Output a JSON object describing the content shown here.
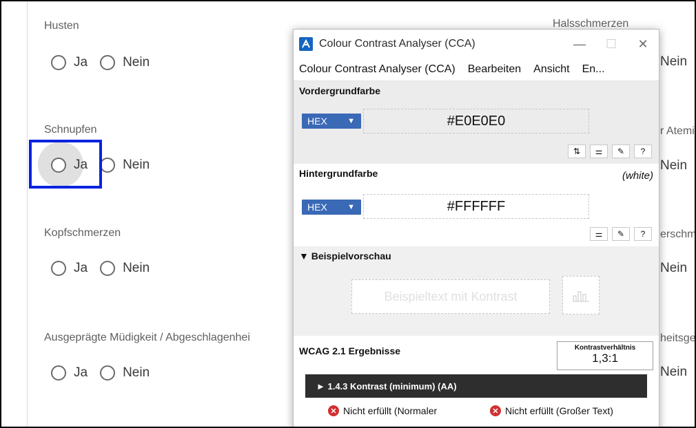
{
  "form": {
    "questions": [
      {
        "label": "Husten",
        "yes": "Ja",
        "no": "Nein"
      },
      {
        "label": "Schnupfen",
        "yes": "Ja",
        "no": "Nein"
      },
      {
        "label": "Kopfschmerzen",
        "yes": "Ja",
        "no": "Nein"
      },
      {
        "label": "Ausgeprägte Müdigkeit / Abgeschlagenhei",
        "yes": "Ja",
        "no": "Nein"
      }
    ],
    "right_column": {
      "labels": [
        "Halsschmerzen",
        "r Atemi",
        "erschm",
        "heitsge"
      ],
      "no_label": "Nein"
    }
  },
  "cca": {
    "window_title": "Colour Contrast Analyser (CCA)",
    "window_controls": {
      "minimize": "—",
      "maximize": "☐",
      "close": "✕"
    },
    "menu": [
      "Colour Contrast Analyser (CCA)",
      "Bearbeiten",
      "Ansicht",
      "En..."
    ],
    "foreground": {
      "title": "Vordergrundfarbe",
      "format": "HEX",
      "value": "#E0E0E0",
      "tools": [
        "⇅",
        "⚌",
        "✎",
        "?"
      ]
    },
    "background": {
      "title": "Hintergrundfarbe",
      "color_name": "(white)",
      "format": "HEX",
      "value": "#FFFFFF",
      "tools": [
        "⚌",
        "✎",
        "?"
      ]
    },
    "preview": {
      "title": "▼ Beispielvorschau",
      "sample_text": "Beispieltext mit Kontrast"
    },
    "wcag": {
      "title": "WCAG 2.1 Ergebnisse",
      "ratio_label": "Kontrastverhältnis",
      "ratio_value": "1,3:1",
      "criterion": "► 1.4.3 Kontrast (minimum) (AA)",
      "result_normal": "Nicht erfüllt (Normaler",
      "result_large": "Nicht erfüllt (Großer Text)"
    }
  },
  "colors": {
    "focus_outline": "#0a22e0",
    "hex_dropdown": "#3a69b6",
    "foreground_color": "#E0E0E0",
    "fail": "#d32f2f"
  }
}
